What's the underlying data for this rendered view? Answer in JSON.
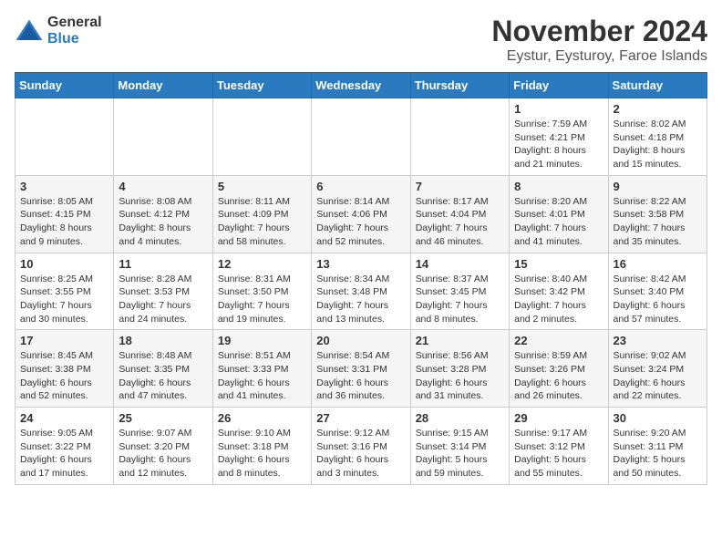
{
  "logo": {
    "general": "General",
    "blue": "Blue"
  },
  "header": {
    "month": "November 2024",
    "location": "Eystur, Eysturoy, Faroe Islands"
  },
  "weekdays": [
    "Sunday",
    "Monday",
    "Tuesday",
    "Wednesday",
    "Thursday",
    "Friday",
    "Saturday"
  ],
  "weeks": [
    [
      {
        "day": "",
        "info": ""
      },
      {
        "day": "",
        "info": ""
      },
      {
        "day": "",
        "info": ""
      },
      {
        "day": "",
        "info": ""
      },
      {
        "day": "",
        "info": ""
      },
      {
        "day": "1",
        "info": "Sunrise: 7:59 AM\nSunset: 4:21 PM\nDaylight: 8 hours and 21 minutes."
      },
      {
        "day": "2",
        "info": "Sunrise: 8:02 AM\nSunset: 4:18 PM\nDaylight: 8 hours and 15 minutes."
      }
    ],
    [
      {
        "day": "3",
        "info": "Sunrise: 8:05 AM\nSunset: 4:15 PM\nDaylight: 8 hours and 9 minutes."
      },
      {
        "day": "4",
        "info": "Sunrise: 8:08 AM\nSunset: 4:12 PM\nDaylight: 8 hours and 4 minutes."
      },
      {
        "day": "5",
        "info": "Sunrise: 8:11 AM\nSunset: 4:09 PM\nDaylight: 7 hours and 58 minutes."
      },
      {
        "day": "6",
        "info": "Sunrise: 8:14 AM\nSunset: 4:06 PM\nDaylight: 7 hours and 52 minutes."
      },
      {
        "day": "7",
        "info": "Sunrise: 8:17 AM\nSunset: 4:04 PM\nDaylight: 7 hours and 46 minutes."
      },
      {
        "day": "8",
        "info": "Sunrise: 8:20 AM\nSunset: 4:01 PM\nDaylight: 7 hours and 41 minutes."
      },
      {
        "day": "9",
        "info": "Sunrise: 8:22 AM\nSunset: 3:58 PM\nDaylight: 7 hours and 35 minutes."
      }
    ],
    [
      {
        "day": "10",
        "info": "Sunrise: 8:25 AM\nSunset: 3:55 PM\nDaylight: 7 hours and 30 minutes."
      },
      {
        "day": "11",
        "info": "Sunrise: 8:28 AM\nSunset: 3:53 PM\nDaylight: 7 hours and 24 minutes."
      },
      {
        "day": "12",
        "info": "Sunrise: 8:31 AM\nSunset: 3:50 PM\nDaylight: 7 hours and 19 minutes."
      },
      {
        "day": "13",
        "info": "Sunrise: 8:34 AM\nSunset: 3:48 PM\nDaylight: 7 hours and 13 minutes."
      },
      {
        "day": "14",
        "info": "Sunrise: 8:37 AM\nSunset: 3:45 PM\nDaylight: 7 hours and 8 minutes."
      },
      {
        "day": "15",
        "info": "Sunrise: 8:40 AM\nSunset: 3:42 PM\nDaylight: 7 hours and 2 minutes."
      },
      {
        "day": "16",
        "info": "Sunrise: 8:42 AM\nSunset: 3:40 PM\nDaylight: 6 hours and 57 minutes."
      }
    ],
    [
      {
        "day": "17",
        "info": "Sunrise: 8:45 AM\nSunset: 3:38 PM\nDaylight: 6 hours and 52 minutes."
      },
      {
        "day": "18",
        "info": "Sunrise: 8:48 AM\nSunset: 3:35 PM\nDaylight: 6 hours and 47 minutes."
      },
      {
        "day": "19",
        "info": "Sunrise: 8:51 AM\nSunset: 3:33 PM\nDaylight: 6 hours and 41 minutes."
      },
      {
        "day": "20",
        "info": "Sunrise: 8:54 AM\nSunset: 3:31 PM\nDaylight: 6 hours and 36 minutes."
      },
      {
        "day": "21",
        "info": "Sunrise: 8:56 AM\nSunset: 3:28 PM\nDaylight: 6 hours and 31 minutes."
      },
      {
        "day": "22",
        "info": "Sunrise: 8:59 AM\nSunset: 3:26 PM\nDaylight: 6 hours and 26 minutes."
      },
      {
        "day": "23",
        "info": "Sunrise: 9:02 AM\nSunset: 3:24 PM\nDaylight: 6 hours and 22 minutes."
      }
    ],
    [
      {
        "day": "24",
        "info": "Sunrise: 9:05 AM\nSunset: 3:22 PM\nDaylight: 6 hours and 17 minutes."
      },
      {
        "day": "25",
        "info": "Sunrise: 9:07 AM\nSunset: 3:20 PM\nDaylight: 6 hours and 12 minutes."
      },
      {
        "day": "26",
        "info": "Sunrise: 9:10 AM\nSunset: 3:18 PM\nDaylight: 6 hours and 8 minutes."
      },
      {
        "day": "27",
        "info": "Sunrise: 9:12 AM\nSunset: 3:16 PM\nDaylight: 6 hours and 3 minutes."
      },
      {
        "day": "28",
        "info": "Sunrise: 9:15 AM\nSunset: 3:14 PM\nDaylight: 5 hours and 59 minutes."
      },
      {
        "day": "29",
        "info": "Sunrise: 9:17 AM\nSunset: 3:12 PM\nDaylight: 5 hours and 55 minutes."
      },
      {
        "day": "30",
        "info": "Sunrise: 9:20 AM\nSunset: 3:11 PM\nDaylight: 5 hours and 50 minutes."
      }
    ]
  ]
}
